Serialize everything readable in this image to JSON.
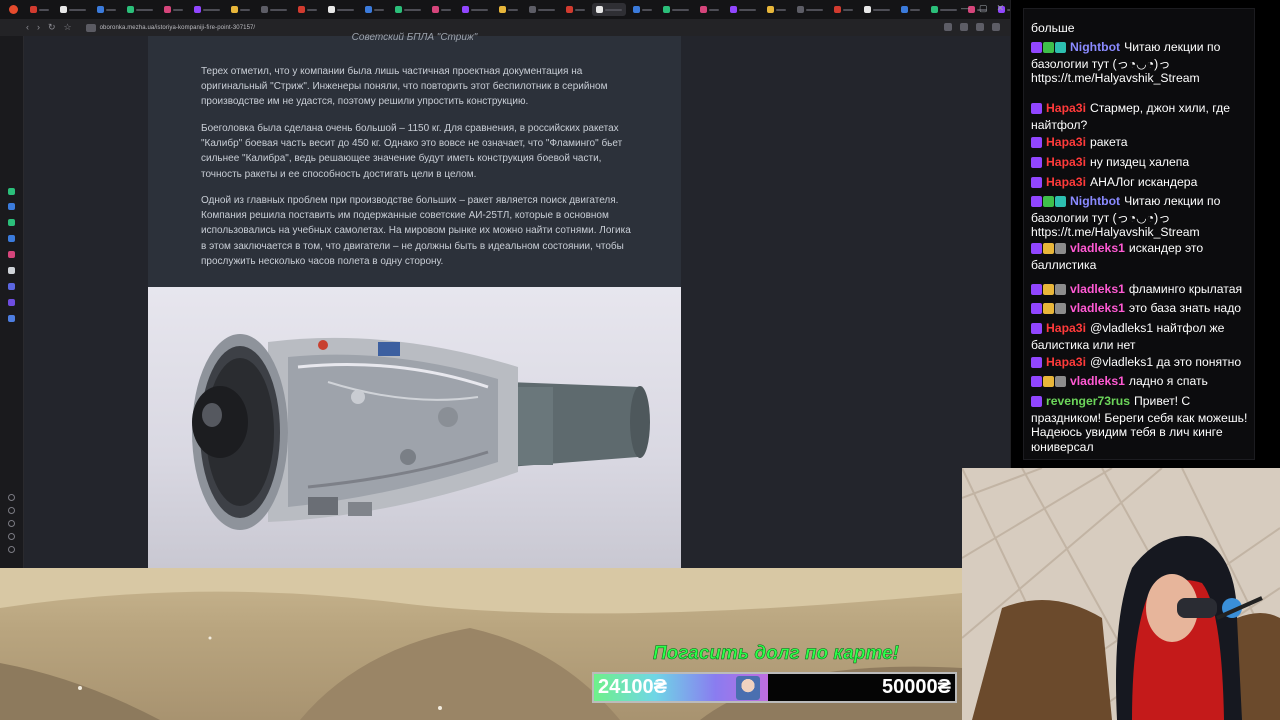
{
  "browser": {
    "url": "oboronka.mezha.ua/istoriya-kompaniji-fire-point-307157/",
    "tab_count": 34,
    "colors": {
      "frame": "#141416",
      "toolbar": "#232326",
      "page_bg": "#23252c",
      "article_bg": "#2c313a"
    },
    "icons": [
      "brave-logo-icon",
      "back-icon",
      "forward-icon",
      "reload-icon",
      "bookmark-icon",
      "shield-icon",
      "extensions-icon",
      "minimize-icon",
      "maximize-icon",
      "close-icon"
    ]
  },
  "article": {
    "caption": "Советский БПЛА \"Стриж\"",
    "paragraphs": [
      "Терех отметил, что у компании была лишь частичная проектная документация на оригинальный \"Стриж\". Инженеры поняли, что повторить этот беспилотник в серийном производстве им не удастся, поэтому решили упростить конструкцию.",
      "Боеголовка была сделана очень большой – 1150 кг. Для сравнения, в российских ракетах \"Калибр\" боевая часть весит до 450 кг. Однако это вовсе не означает, что \"Фламинго\" бьет сильнее \"Калибра\", ведь решающее значение будут иметь конструкция боевой части, точность ракеты и ее способность достигать цели в целом.",
      "Одной из главных проблем при производстве больших – ракет является поиск двигателя. Компания решила поставить им подержанные советские АИ-25ТЛ, которые в основном использовались на учебных самолетах. На мировом рынке их можно найти сотнями. Логика в этом заключается в том, что двигатели – не должны быть в идеальном состоянии, чтобы прослужить несколько часов полета в одну сторону."
    ]
  },
  "chat": {
    "messages": [
      {
        "user": "",
        "color": "#ffffff",
        "text": "больше",
        "badges": []
      },
      {
        "user": "Nightbot",
        "color": "#8a8aff",
        "text": "Читаю лекции по базологии тут (っ◔◡◔)っ https://t.me/Halyavshik_Stream",
        "badges": [
          "#9146ff",
          "#3fbf4b",
          "#2dbfb0"
        ]
      },
      {
        "user": "Нара3і",
        "color": "#ff3a3a",
        "text": "Стармер, джон хили, где найтфол?",
        "badges": [
          "#9146ff"
        ]
      },
      {
        "user": "Нара3і",
        "color": "#ff3a3a",
        "text": "ракета",
        "badges": [
          "#9146ff"
        ]
      },
      {
        "user": "Нара3і",
        "color": "#ff3a3a",
        "text": "ну пиздец халепа",
        "badges": [
          "#9146ff"
        ]
      },
      {
        "user": "Нара3і",
        "color": "#ff3a3a",
        "text": "АНАЛог искандера",
        "badges": [
          "#9146ff"
        ]
      },
      {
        "user": "Nightbot",
        "color": "#8a8aff",
        "text": "Читаю лекции по базологии тут (っ◔◡◔)っ https://t.me/Halyavshik_Stream",
        "badges": [
          "#9146ff",
          "#3fbf4b",
          "#2dbfb0"
        ]
      },
      {
        "user": "vladleks1",
        "color": "#ff5ad3",
        "text": "искандер это баллистика",
        "badges": [
          "#9146ff",
          "#e8b63a",
          "#8c8c8c"
        ]
      },
      {
        "user": "vladleks1",
        "color": "#ff5ad3",
        "text": "фламинго крылатая",
        "badges": [
          "#9146ff",
          "#e8b63a",
          "#8c8c8c"
        ]
      },
      {
        "user": "vladleks1",
        "color": "#ff5ad3",
        "text": "это база знать надо",
        "badges": [
          "#9146ff",
          "#e8b63a",
          "#8c8c8c"
        ]
      },
      {
        "user": "Нара3і",
        "color": "#ff3a3a",
        "text": "@vladleks1 найтфол же балистика или нет",
        "badges": [
          "#9146ff"
        ]
      },
      {
        "user": "Нара3і",
        "color": "#ff3a3a",
        "text": "@vladleks1 да это понятно",
        "badges": [
          "#9146ff"
        ]
      },
      {
        "user": "vladleks1",
        "color": "#ff5ad3",
        "text": "ладно я спать",
        "badges": [
          "#9146ff",
          "#e8b63a",
          "#8c8c8c"
        ]
      },
      {
        "user": "revenger73rus",
        "color": "#6cd55a",
        "text": "Привет! С праздником! Береги себя как можешь! Надеюсь увидим тебя в лич кинге юниверсал",
        "badges": [
          "#9146ff"
        ]
      }
    ]
  },
  "donation_goal": {
    "title": "Погасить долг по карте!",
    "current": "24100₴",
    "target": "50000₴",
    "progress": 0.482
  }
}
